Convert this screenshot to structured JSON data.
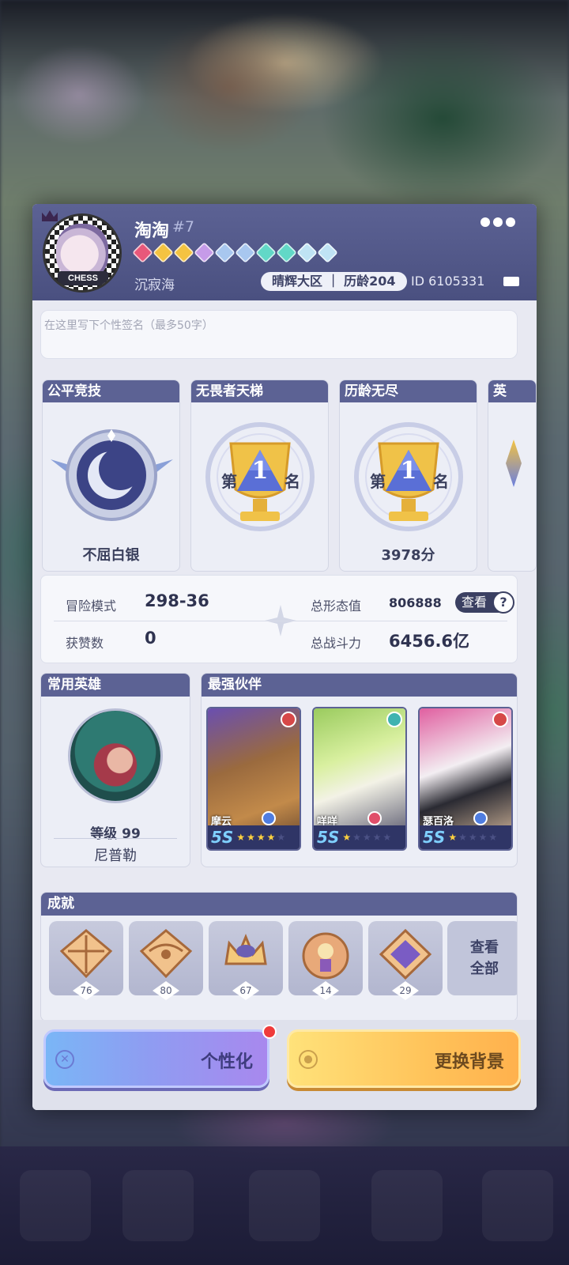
{
  "profile": {
    "name": "淘淘",
    "tag": "#7",
    "subname": "沉寂海",
    "server": "晴辉大区 ｜ 历龄204",
    "uid": "ID 6105331",
    "avatar_badge": "CHESS"
  },
  "signature": {
    "placeholder": "在这里写下个性签名（最多50字）"
  },
  "ranks": [
    {
      "title": "公平竞技",
      "value": "不屈白银",
      "emblem": "silver-moon-emblem"
    },
    {
      "title": "无畏者天梯",
      "value": "",
      "emblem": "first-place-trophy"
    },
    {
      "title": "历龄无尽",
      "value": "3978分",
      "emblem": "first-place-trophy"
    },
    {
      "title": "英",
      "value": "",
      "emblem": "partial-emblem"
    }
  ],
  "trophy_text": {
    "left": "第",
    "num": "1",
    "right": "名"
  },
  "stats": {
    "adventure_label": "冒险模式",
    "adventure_value": "298-36",
    "likes_label": "获赞数",
    "likes_value": "0",
    "form_label": "总形态值",
    "form_value": "806888",
    "power_label": "总战斗力",
    "power_value": "6456.6亿",
    "view_label": "查看",
    "help_symbol": "?"
  },
  "common_hero": {
    "title": "常用英雄",
    "level": "等级 99",
    "name": "尼普勒"
  },
  "partners": {
    "title": "最强伙伴",
    "items": [
      {
        "name": "摩云",
        "grade": "5S",
        "stars": 4
      },
      {
        "name": "咩咩",
        "grade": "5S",
        "stars": 1
      },
      {
        "name": "瑟百洛",
        "grade": "5S",
        "stars": 1
      }
    ]
  },
  "achievements": {
    "title": "成就",
    "items": [
      {
        "count": "76"
      },
      {
        "count": "80"
      },
      {
        "count": "67"
      },
      {
        "count": "14"
      },
      {
        "count": "29"
      }
    ],
    "view_all_line1": "查看",
    "view_all_line2": "全部"
  },
  "buttons": {
    "customize": "个性化",
    "change_background": "更换背景"
  },
  "colors": {
    "header": "#5c6294",
    "accent_red": "#ef3b3b",
    "customize_button": "#8e9df2",
    "background_button": "#ffc35a"
  }
}
